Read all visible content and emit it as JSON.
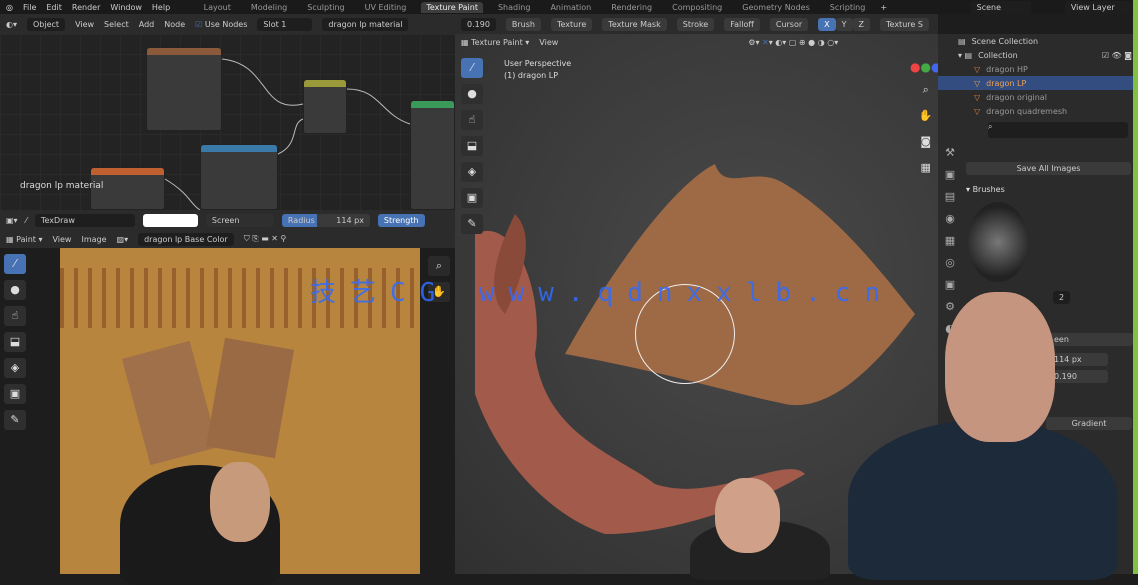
{
  "topbar": {
    "menus": [
      "File",
      "Edit",
      "Render",
      "Window",
      "Help"
    ],
    "workspaces": [
      "Layout",
      "Modeling",
      "Sculpting",
      "UV Editing",
      "Texture Paint",
      "Shading",
      "Animation",
      "Rendering",
      "Compositing",
      "Geometry Nodes",
      "Scripting"
    ],
    "active_workspace": "Texture Paint",
    "add_tab": "+",
    "scene": "Scene",
    "view_layer": "View Layer"
  },
  "node_header": {
    "mode": "Object",
    "view": "View",
    "select": "Select",
    "add": "Add",
    "node": "Node",
    "use_nodes": "Use Nodes",
    "slot": "Slot 1",
    "material": "dragon lp material"
  },
  "node_editor": {
    "label": "dragon lp material"
  },
  "viewport_header": {
    "strength": "0.190",
    "brush": "Brush",
    "texture": "Texture",
    "texture_mask": "Texture Mask",
    "stroke": "Stroke",
    "falloff": "Falloff",
    "cursor": "Cursor",
    "axes": [
      "X",
      "Y",
      "Z"
    ],
    "texture_slots": "Texture S",
    "mode": "Texture Paint",
    "view": "View"
  },
  "viewport": {
    "perspective": "User Perspective",
    "object": "(1) dragon LP"
  },
  "image_tool": {
    "brush": "TexDraw",
    "blend": "Screen",
    "radius_label": "Radius",
    "radius": "114 px",
    "strength_label": "Strength"
  },
  "image_header": {
    "mode": "Paint",
    "view": "View",
    "image": "Image",
    "image_name": "dragon lp Base Color"
  },
  "outliner": {
    "root": "Scene Collection",
    "collection": "Collection",
    "items": [
      {
        "name": "dragon HP",
        "selected": false
      },
      {
        "name": "dragon LP",
        "selected": true
      },
      {
        "name": "dragon original",
        "selected": false
      },
      {
        "name": "dragon quadremesh",
        "selected": false
      }
    ]
  },
  "properties": {
    "save_all": "Save All Images",
    "brushes": "Brushes",
    "brush_users": "2",
    "blend_partial": "een",
    "radius": "114 px",
    "strength": "0.190",
    "gradient": "Gradient"
  },
  "watermark": "技艺CG www.qdnxxlb.cn",
  "colors": {
    "accent": "#4772b3",
    "texture": "#b7853e",
    "selected_row": "#334d80"
  }
}
